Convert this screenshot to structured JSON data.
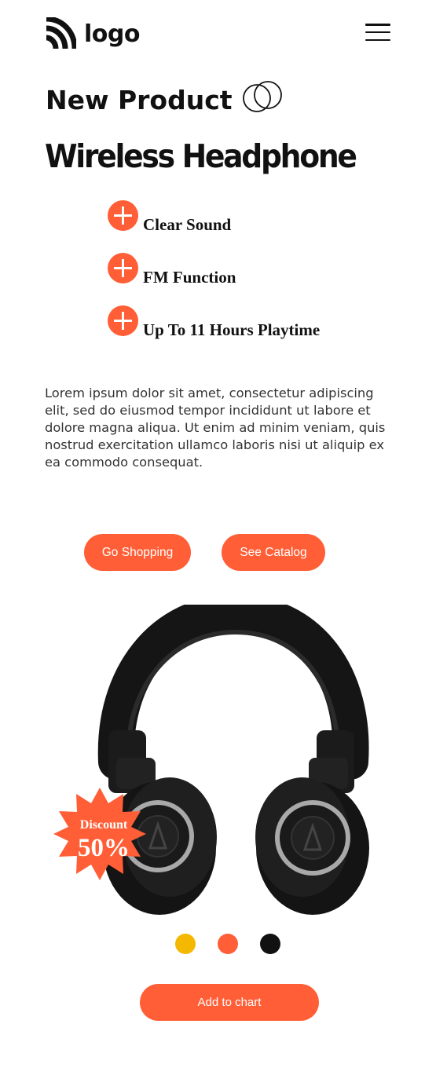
{
  "header": {
    "logo_text": "logo",
    "logo_icon": "wifi-signal-icon",
    "menu_icon": "hamburger-menu-icon"
  },
  "hero": {
    "subtitle": "New Product",
    "title": "Wireless Headphone",
    "features": [
      {
        "icon": "plus-circle-icon",
        "label": "Clear Sound"
      },
      {
        "icon": "plus-circle-icon",
        "label": "FM Function"
      },
      {
        "icon": "plus-circle-icon",
        "label": "Up To 11 Hours Playtime"
      }
    ],
    "description": "Lorem ipsum dolor sit amet, consectetur adipiscing elit, sed do eiusmod tempor incididunt ut labore et dolore magna aliqua. Ut enim ad minim veniam, quis nostrud exercitation ullamco laboris nisi ut aliquip ex ea commodo consequat."
  },
  "actions": {
    "shop_label": "Go Shopping",
    "catalog_label": "See Catalog"
  },
  "product": {
    "discount_label": "Discount",
    "discount_value": "50%"
  },
  "color_options": [
    "#f5b800",
    "#ff5e36",
    "#111111"
  ],
  "cart": {
    "add_label": "Add to chart"
  },
  "colors": {
    "accent": "#ff5e36",
    "text": "#111111"
  }
}
